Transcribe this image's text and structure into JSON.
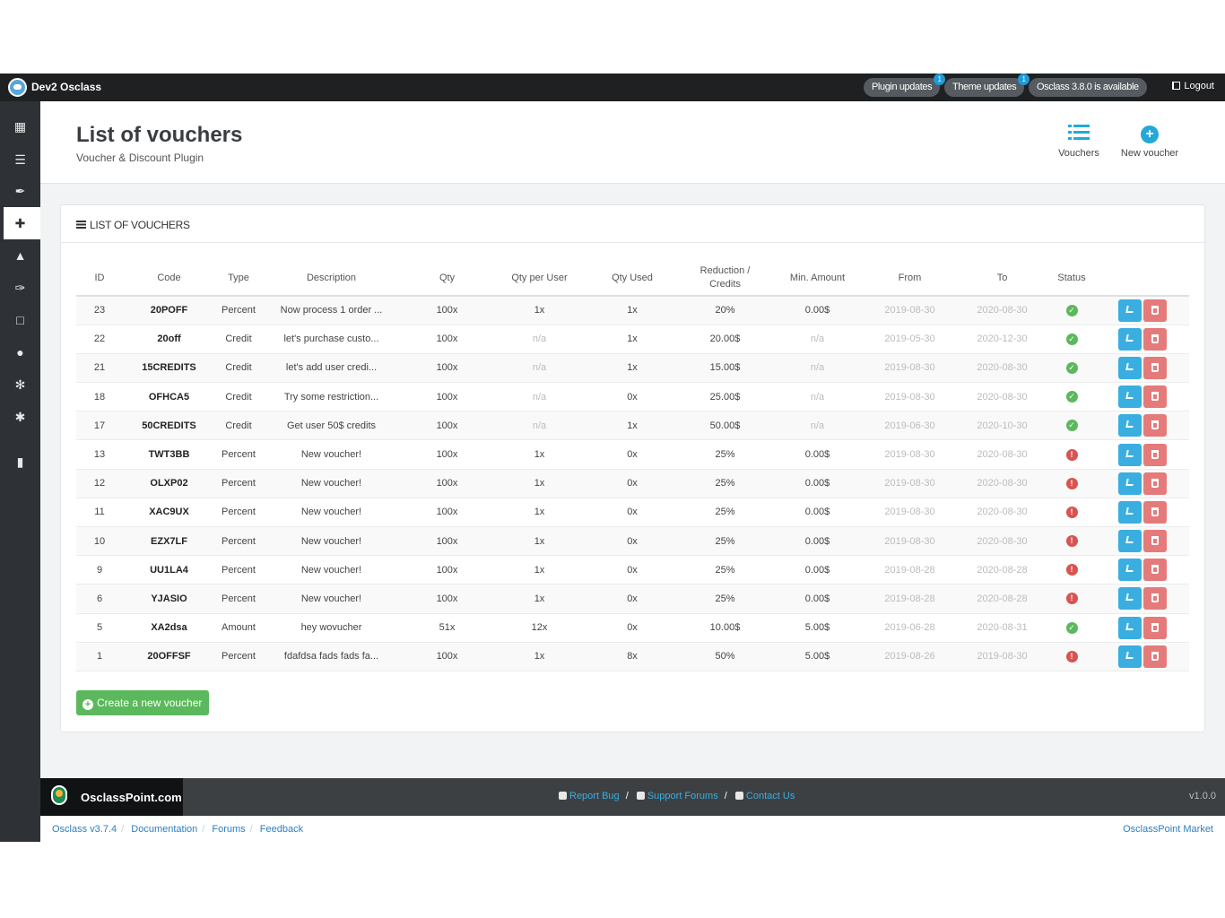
{
  "topbar": {
    "site_name": "Dev2 Osclass",
    "plugin_updates": {
      "label": "Plugin updates",
      "badge": "1"
    },
    "theme_updates": {
      "label": "Theme updates",
      "badge": "1"
    },
    "osclass_available": "Osclass 3.8.0 is available",
    "logout": "Logout"
  },
  "sidebar": {
    "items": [
      {
        "icon": "briefcase-icon"
      },
      {
        "icon": "menu-icon"
      },
      {
        "icon": "brush-icon"
      },
      {
        "icon": "puzzle-icon",
        "active": true
      },
      {
        "icon": "chart-icon"
      },
      {
        "icon": "wrench-icon"
      },
      {
        "icon": "page-icon"
      },
      {
        "icon": "user-icon"
      },
      {
        "icon": "cogs-icon"
      },
      {
        "icon": "gear-icon"
      },
      {
        "icon": "barcode-icon"
      }
    ]
  },
  "header": {
    "title": "List of vouchers",
    "subtitle": "Voucher & Discount Plugin",
    "actions": {
      "vouchers": "Vouchers",
      "new_voucher": "New voucher"
    },
    "accent": "#23a9d9"
  },
  "card": {
    "title": "LIST OF VOUCHERS",
    "columns": [
      "ID",
      "Code",
      "Type",
      "Description",
      "Qty",
      "Qty per User",
      "Qty Used",
      "Reduction / Credits",
      "Min. Amount",
      "From",
      "To",
      "Status"
    ],
    "rows": [
      {
        "id": "23",
        "code": "20POFF",
        "type": "Percent",
        "description": "Now process 1 order ...",
        "qty": "100x",
        "qty_per_user": "1x",
        "qty_used": "1x",
        "reduction": "20%",
        "min_amount": "0.00$",
        "from": "2019-08-30",
        "to": "2020-08-30",
        "status": "ok"
      },
      {
        "id": "22",
        "code": "20off",
        "type": "Credit",
        "description": "let's purchase custo...",
        "qty": "100x",
        "qty_per_user": "n/a",
        "qty_used": "1x",
        "reduction": "20.00$",
        "min_amount": "n/a",
        "from": "2019-05-30",
        "to": "2020-12-30",
        "status": "ok"
      },
      {
        "id": "21",
        "code": "15CREDITS",
        "type": "Credit",
        "description": "let's add user credi...",
        "qty": "100x",
        "qty_per_user": "n/a",
        "qty_used": "1x",
        "reduction": "15.00$",
        "min_amount": "n/a",
        "from": "2019-08-30",
        "to": "2020-08-30",
        "status": "ok"
      },
      {
        "id": "18",
        "code": "OFHCA5",
        "type": "Credit",
        "description": "Try some restriction...",
        "qty": "100x",
        "qty_per_user": "n/a",
        "qty_used": "0x",
        "reduction": "25.00$",
        "min_amount": "n/a",
        "from": "2019-08-30",
        "to": "2020-08-30",
        "status": "ok"
      },
      {
        "id": "17",
        "code": "50CREDITS",
        "type": "Credit",
        "description": "Get user 50$ credits",
        "qty": "100x",
        "qty_per_user": "n/a",
        "qty_used": "1x",
        "reduction": "50.00$",
        "min_amount": "n/a",
        "from": "2019-06-30",
        "to": "2020-10-30",
        "status": "ok"
      },
      {
        "id": "13",
        "code": "TWT3BB",
        "type": "Percent",
        "description": "New voucher!",
        "qty": "100x",
        "qty_per_user": "1x",
        "qty_used": "0x",
        "reduction": "25%",
        "min_amount": "0.00$",
        "from": "2019-08-30",
        "to": "2020-08-30",
        "status": "bad"
      },
      {
        "id": "12",
        "code": "OLXP02",
        "type": "Percent",
        "description": "New voucher!",
        "qty": "100x",
        "qty_per_user": "1x",
        "qty_used": "0x",
        "reduction": "25%",
        "min_amount": "0.00$",
        "from": "2019-08-30",
        "to": "2020-08-30",
        "status": "bad"
      },
      {
        "id": "11",
        "code": "XAC9UX",
        "type": "Percent",
        "description": "New voucher!",
        "qty": "100x",
        "qty_per_user": "1x",
        "qty_used": "0x",
        "reduction": "25%",
        "min_amount": "0.00$",
        "from": "2019-08-30",
        "to": "2020-08-30",
        "status": "bad"
      },
      {
        "id": "10",
        "code": "EZX7LF",
        "type": "Percent",
        "description": "New voucher!",
        "qty": "100x",
        "qty_per_user": "1x",
        "qty_used": "0x",
        "reduction": "25%",
        "min_amount": "0.00$",
        "from": "2019-08-30",
        "to": "2020-08-30",
        "status": "bad"
      },
      {
        "id": "9",
        "code": "UU1LA4",
        "type": "Percent",
        "description": "New voucher!",
        "qty": "100x",
        "qty_per_user": "1x",
        "qty_used": "0x",
        "reduction": "25%",
        "min_amount": "0.00$",
        "from": "2019-08-28",
        "to": "2020-08-28",
        "status": "bad"
      },
      {
        "id": "6",
        "code": "YJASIO",
        "type": "Percent",
        "description": "New voucher!",
        "qty": "100x",
        "qty_per_user": "1x",
        "qty_used": "0x",
        "reduction": "25%",
        "min_amount": "0.00$",
        "from": "2019-08-28",
        "to": "2020-08-28",
        "status": "bad"
      },
      {
        "id": "5",
        "code": "XA2dsa",
        "type": "Amount",
        "description": "hey wovucher",
        "qty": "51x",
        "qty_per_user": "12x",
        "qty_used": "0x",
        "reduction": "10.00$",
        "min_amount": "5.00$",
        "from": "2019-06-28",
        "to": "2020-08-31",
        "status": "ok"
      },
      {
        "id": "1",
        "code": "20OFFSF",
        "type": "Percent",
        "description": "fdafdsa fads fads fa...",
        "qty": "100x",
        "qty_per_user": "1x",
        "qty_used": "8x",
        "reduction": "50%",
        "min_amount": "5.00$",
        "from": "2019-08-26",
        "to": "2019-08-30",
        "status": "bad"
      }
    ],
    "create_button": "Create a new voucher"
  },
  "footer": {
    "brand": "OsclassPoint.com",
    "report_bug": "Report Bug",
    "support_forums": "Support Forums",
    "contact_us": "Contact Us",
    "separator": "/",
    "version": "v1.0.0",
    "bottom_links": [
      "Osclass v3.7.4",
      "Documentation",
      "Forums",
      "Feedback"
    ],
    "market": "OsclassPoint Market"
  }
}
